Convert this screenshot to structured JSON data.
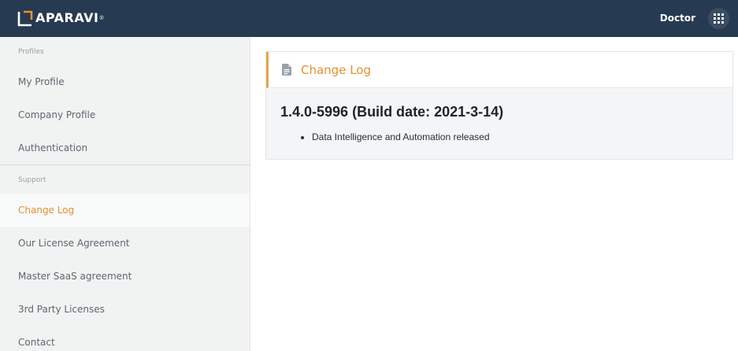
{
  "header": {
    "logo_text": "APARAVI",
    "logo_mark": "®",
    "user_name": "Doctor",
    "apps_icon": "grid-icon",
    "colors": {
      "bar": "#263a52",
      "accent": "#e3912f"
    }
  },
  "sidebar": {
    "sections": [
      {
        "label": "Profiles",
        "items": [
          {
            "label": "My Profile"
          },
          {
            "label": "Company Profile"
          },
          {
            "label": "Authentication"
          }
        ]
      },
      {
        "label": "Support",
        "items": [
          {
            "label": "Change Log",
            "active": true
          },
          {
            "label": "Our License Agreement"
          },
          {
            "label": "Master SaaS agreement"
          },
          {
            "label": "3rd Party Licenses"
          },
          {
            "label": "Contact"
          }
        ]
      }
    ]
  },
  "main": {
    "card_title": "Change Log",
    "card_icon": "document-icon",
    "version_heading": "1.4.0-5996 (Build date: 2021-3-14)",
    "notes": [
      "Data Intelligence and Automation released"
    ]
  }
}
